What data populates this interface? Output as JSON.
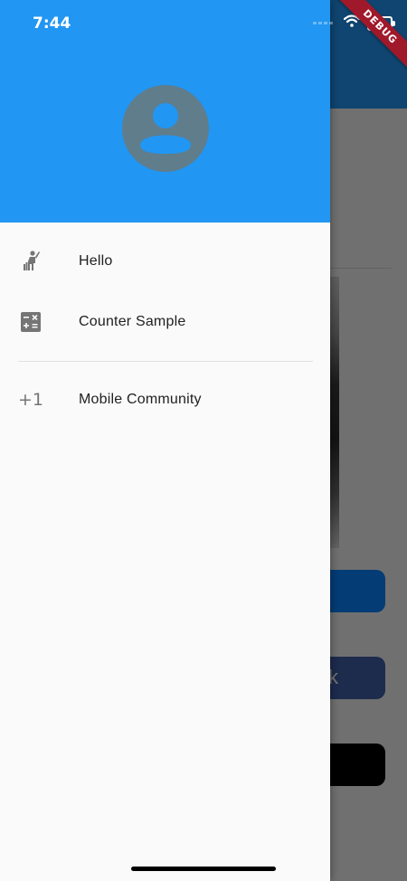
{
  "status_bar": {
    "time": "7:44",
    "debug_label": "DEBUG"
  },
  "drawer": {
    "header_color": "#2196f3",
    "avatar_icon": "account-circle-icon",
    "items": [
      {
        "label": "Hello",
        "icon": "human-greeting-icon"
      },
      {
        "label": "Counter Sample",
        "icon": "calculator-icon"
      },
      {
        "label": "Mobile Community",
        "icon": "plus-one-icon",
        "icon_text": "+1"
      }
    ]
  },
  "background_app": {
    "button_text_fragment": "k"
  },
  "colors": {
    "primary": "#2196f3",
    "drawer_bg": "#fafafa",
    "icon_grey": "#757575",
    "debug_red": "#a0192b"
  }
}
